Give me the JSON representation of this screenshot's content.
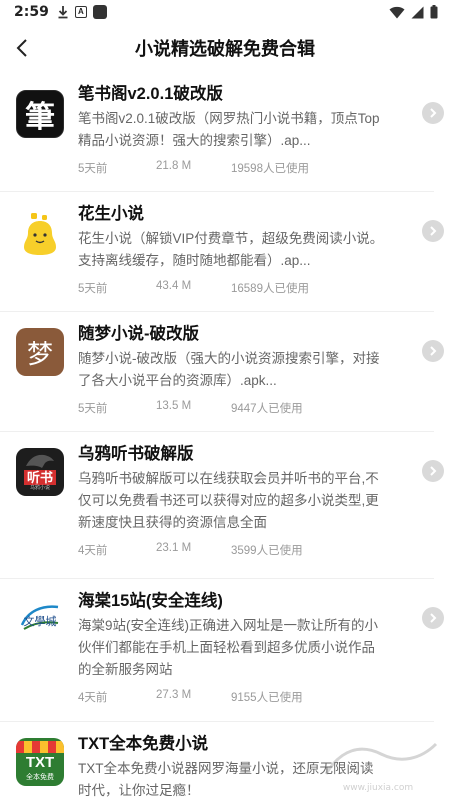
{
  "status_bar": {
    "time": "2:59",
    "icons": [
      "download-icon",
      "a-icon",
      "notification-square-icon",
      "wifi-icon",
      "signal-icon",
      "battery-icon"
    ]
  },
  "header": {
    "title": "小说精选破解免费合辑",
    "back_icon": "chevron-left-icon"
  },
  "items": [
    {
      "title": "笔书阁v2.0.1破改版",
      "desc": "笔书阁v2.0.1破改版（网罗热门小说书籍，顶点Top精品小说资源！强大的搜索引擎）.ap...",
      "time": "5天前",
      "size": "21.8 M",
      "users": "19598人已使用",
      "icon": "bishuge-app-icon",
      "icon_text": "筆"
    },
    {
      "title": "花生小说",
      "desc": "花生小说（解锁VIP付费章节，超级免费阅读小说。支持离线缓存，随时随地都能看）.ap...",
      "time": "5天前",
      "size": "43.4 M",
      "users": "16589人已使用",
      "icon": "huasheng-app-icon",
      "icon_text": ""
    },
    {
      "title": "随梦小说-破改版",
      "desc": "随梦小说-破改版（强大的小说资源搜索引擎，对接了各大小说平台的资源库）.apk...",
      "time": "5天前",
      "size": "13.5 M",
      "users": "9447人已使用",
      "icon": "suimeng-app-icon",
      "icon_text": "梦"
    },
    {
      "title": "乌鸦听书破解版",
      "desc": "乌鸦听书破解版可以在线获取会员并听书的平台,不仅可以免费看书还可以获得对应的超多小说类型,更新速度快且获得的资源信息全面",
      "time": "4天前",
      "size": "23.1 M",
      "users": "3599人已使用",
      "icon": "wuya-app-icon",
      "icon_text": "听书"
    },
    {
      "title": "海棠15站(安全连线)",
      "desc": "海棠9站(安全连线)正确进入网址是一款让所有的小伙伴们都能在手机上面轻松看到超多优质小说作品的全新服务网站",
      "time": "4天前",
      "size": "27.3 M",
      "users": "9155人已使用",
      "icon": "haitang-app-icon",
      "icon_text": "文學城"
    },
    {
      "title": "TXT全本免费小说",
      "desc": "TXT全本免费小说器网罗海量小说，还原无限阅读时代，让你过足瘾！",
      "time": "",
      "size": "",
      "users": "",
      "icon": "txt-app-icon",
      "icon_text": "TXT"
    }
  ],
  "icon_extra": {
    "txt_sub": "全本免费",
    "wuya_sub": "乌鸦小说"
  },
  "watermark": "www.jiuxia.com"
}
